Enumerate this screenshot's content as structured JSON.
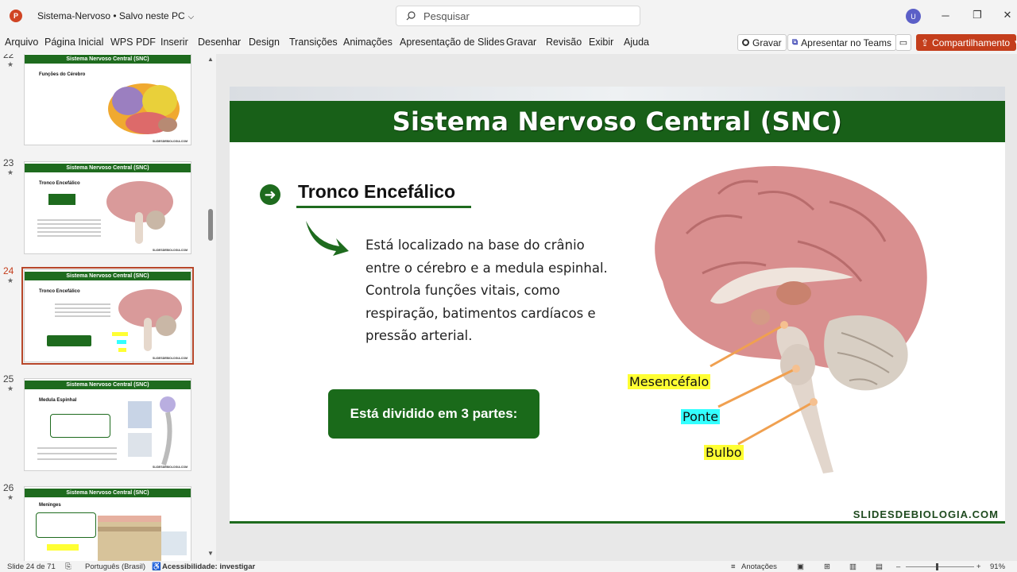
{
  "app": {
    "logo_letter": "P",
    "doc_title": "Sistema-Nervoso • Salvo neste PC",
    "search_placeholder": "Pesquisar",
    "user_initial": "U"
  },
  "ribbon": {
    "tabs": [
      "Arquivo",
      "Página Inicial",
      "WPS PDF",
      "Inserir",
      "Desenhar",
      "Design",
      "Transições",
      "Animações",
      "Apresentação de Slides",
      "Gravar",
      "Revisão",
      "Exibir",
      "Ajuda"
    ],
    "record_label": "Gravar",
    "teams_label": "Apresentar no Teams",
    "share_label": "Compartilhamento"
  },
  "thumbnails": [
    {
      "number": "22",
      "title": "Sistema Nervoso Central (SNC)",
      "subtitle": "Funções do Cérebro",
      "selected": false
    },
    {
      "number": "23",
      "title": "Sistema Nervoso Central (SNC)",
      "subtitle": "Tronco Encefálico",
      "selected": false
    },
    {
      "number": "24",
      "title": "Sistema Nervoso Central (SNC)",
      "subtitle": "Tronco Encefálico",
      "selected": true
    },
    {
      "number": "25",
      "title": "Sistema Nervoso Central (SNC)",
      "subtitle": "Medula Espinhal",
      "selected": false
    },
    {
      "number": "26",
      "title": "Sistema Nervoso Central (SNC)",
      "subtitle": "Meninges",
      "selected": false
    }
  ],
  "slide": {
    "title": "Sistema Nervoso Central (SNC)",
    "subtitle": "Tronco Encefálico",
    "body": "Está localizado na base do crânio entre o cérebro e a medula espinhal. Controla funções vitais, como respiração, batimentos cardíacos e pressão arterial.",
    "box_text": "Está dividido em 3 partes:",
    "labels": {
      "mesencefalo": "Mesencéfalo",
      "ponte": "Ponte",
      "bulbo": "Bulbo"
    },
    "footer": "SLIDESDEBIOLOGIA.COM"
  },
  "status": {
    "slide_info": "Slide 24 de 71",
    "language": "Português (Brasil)",
    "accessibility": "Acessibilidade: investigar",
    "notes": "Anotações",
    "zoom": "91%"
  },
  "colors": {
    "green": "#186018",
    "accent": "#c43e1c",
    "yellow_label": "#ffff33",
    "cyan_label": "#33ffff"
  }
}
